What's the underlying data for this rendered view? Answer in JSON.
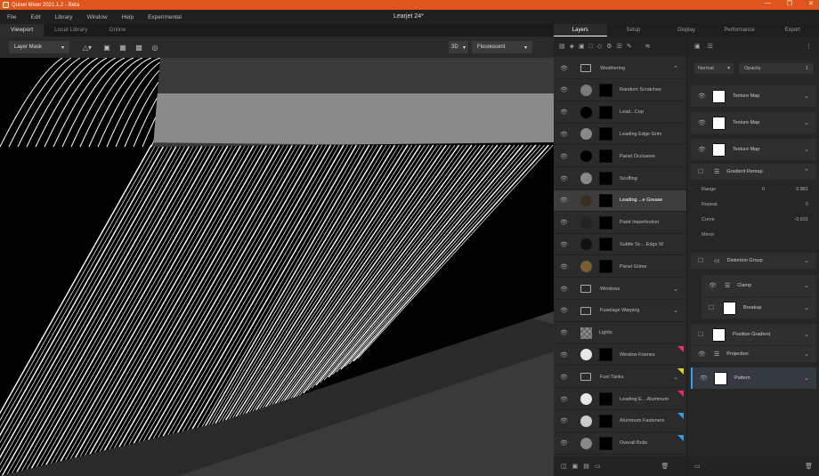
{
  "titlebar": {
    "title": "Quixel Mixer 2021.1.2 - Beta",
    "min": "—",
    "max": "❐",
    "close": "✕"
  },
  "menu": [
    "File",
    "Edit",
    "Library",
    "Window",
    "Help",
    "Experimental"
  ],
  "document_title": "Learjet 24*",
  "viewport_tabs": [
    "Viewport",
    "Local Library",
    "Online"
  ],
  "toolbar": {
    "mode": "Layer Mask",
    "view_mode": "3D",
    "lighting": "Flourescent"
  },
  "panel_tabs": [
    "Layers",
    "Setup",
    "Display",
    "Performance",
    "Export"
  ],
  "layers": [
    {
      "name": "Weathering",
      "type": "folder"
    },
    {
      "name": "Random Scratches",
      "circle": "#7a7a7a"
    },
    {
      "name": "Lead...Cop",
      "circle": "#000000"
    },
    {
      "name": "Leading Edge Grim",
      "circle": "#888888"
    },
    {
      "name": "Panel Occlusion",
      "circle": "#000000"
    },
    {
      "name": "Scuffing",
      "circle": "#888888"
    },
    {
      "name": "Leading ...e Grease",
      "circle": "#3a2e20"
    },
    {
      "name": "Paint Imperfection",
      "circle": "#222222"
    },
    {
      "name": "Subtle Sc... Edge W",
      "circle": "#111111"
    },
    {
      "name": "Panel Grime",
      "circle": "#7a5e30"
    },
    {
      "name": "Windows",
      "type": "folder"
    },
    {
      "name": "Fuselage Warping",
      "type": "folder"
    },
    {
      "name": "Lights",
      "type": "checker"
    },
    {
      "name": "Window Frames",
      "circle": "#e8e8e8",
      "tag": "#e0306a"
    },
    {
      "name": "Fuel Tanks",
      "type": "folder",
      "tag": "#e8d020"
    },
    {
      "name": "Leading E... Aluminum",
      "circle": "#e8e8e8",
      "tag": "#e0306a"
    },
    {
      "name": "Aluminum Fasteners",
      "circle": "#cccccc",
      "tag": "#3a9ae0"
    },
    {
      "name": "Overall Bolts",
      "circle": "#888888",
      "tag": "#3a9ae0"
    }
  ],
  "right_panel": {
    "blend": "Normal",
    "opacity_label": "Opacity",
    "opacity": "1",
    "items": [
      {
        "name": "Texture Map"
      },
      {
        "name": "Texture Map"
      },
      {
        "name": "Texture Map"
      },
      {
        "name": "Gradient Remap"
      },
      {
        "name": "Distortion Group"
      },
      {
        "name": "Clamp"
      },
      {
        "name": "Breakup"
      },
      {
        "name": "Position Gradient"
      },
      {
        "name": "Projection"
      },
      {
        "name": "Pattern"
      }
    ],
    "props": [
      {
        "label": "Range",
        "v1": "0",
        "v2": "0.881"
      },
      {
        "label": "Repeat",
        "v1": "",
        "v2": "0"
      },
      {
        "label": "Curve",
        "v1": "",
        "v2": "-0.691"
      },
      {
        "label": "Mirror",
        "v1": "",
        "v2": ""
      }
    ]
  },
  "colors": {
    "titlebar": "#e0551c",
    "accent": "#3aa0e8"
  }
}
